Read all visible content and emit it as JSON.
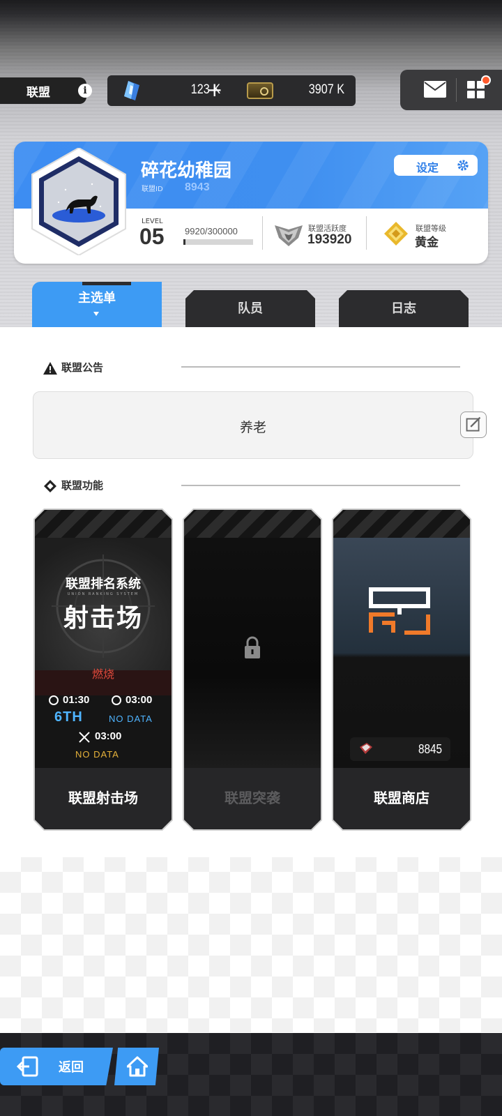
{
  "topbar": {
    "title": "联盟",
    "resource1_amount": "123 K",
    "resource1_plus": "+",
    "resource2_amount": "3907 K"
  },
  "union": {
    "name": "碎花幼稚园",
    "id_label": "联盟ID",
    "id": "8943",
    "settings_label": "设定",
    "level_label": "LEVEL",
    "level": "05",
    "exp_text": "9920/300000",
    "exp_progress": 0.033,
    "activity_label": "联盟活跃度",
    "activity_value": "193920",
    "grade_label": "联盟等级",
    "grade_value": "黄金"
  },
  "tabs": [
    {
      "label": "主选单",
      "active": true
    },
    {
      "label": "队员",
      "active": false
    },
    {
      "label": "日志",
      "active": false
    }
  ],
  "announcement": {
    "heading": "联盟公告",
    "text": "养老"
  },
  "functions": {
    "heading": "联盟功能",
    "cards": [
      {
        "label": "联盟射击场",
        "art_title": "联盟排名系统",
        "art_subtitle": "UNION RANKING SYSTEM",
        "art_big": "射击场",
        "status": "燃烧",
        "time1": "01:30",
        "time2": "03:00",
        "rank": "6TH",
        "rank_data": "NO DATA",
        "time3": "03:00",
        "time3_data": "NO DATA"
      },
      {
        "label": "联盟突袭",
        "locked": true
      },
      {
        "label": "联盟商店",
        "price": "8845"
      }
    ]
  },
  "bottom": {
    "back_label": "返回"
  },
  "colors": {
    "accent": "#3d9bf4",
    "dark": "#2c2c2e",
    "notification": "#ff5a2c"
  }
}
